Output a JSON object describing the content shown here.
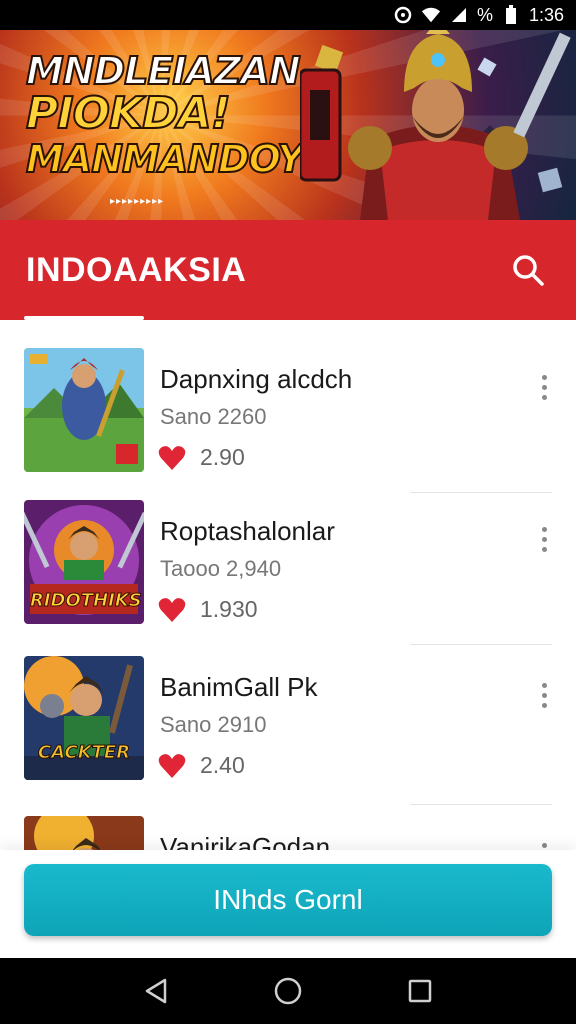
{
  "status_bar": {
    "battery_percent": "%",
    "time": "1:36",
    "icons": [
      "alarm-icon",
      "wifi-icon",
      "signal-icon",
      "battery-icon"
    ]
  },
  "banner": {
    "line1": "MNDLEIAZAN",
    "line2": "PIOKDA!",
    "line3": "MANMANDOY",
    "arrows": "▸▸▸▸▸▸▸▸▸"
  },
  "header": {
    "title": "INDOAAKSIA",
    "search_icon": "search-icon",
    "accent": "#d8262d"
  },
  "games": [
    {
      "title": "Dapnxing alcdch",
      "subtitle": "Sano 2260",
      "likes": "2.90"
    },
    {
      "title": "Roptashalonlar",
      "subtitle": "Taooo 2,940",
      "likes": "1.930",
      "thumb_text": "RIDOTHIKS"
    },
    {
      "title": "BanimGall Pk",
      "subtitle": "Sano 2910",
      "likes": "2.40",
      "thumb_text": "CACKTER"
    },
    {
      "title": "VanirikaGodan",
      "subtitle": "",
      "likes": ""
    }
  ],
  "cta": {
    "label": "INhds Gornl",
    "color": "#14b0c4"
  },
  "nav": {
    "icons": [
      "back-icon",
      "home-icon",
      "recents-icon"
    ]
  }
}
